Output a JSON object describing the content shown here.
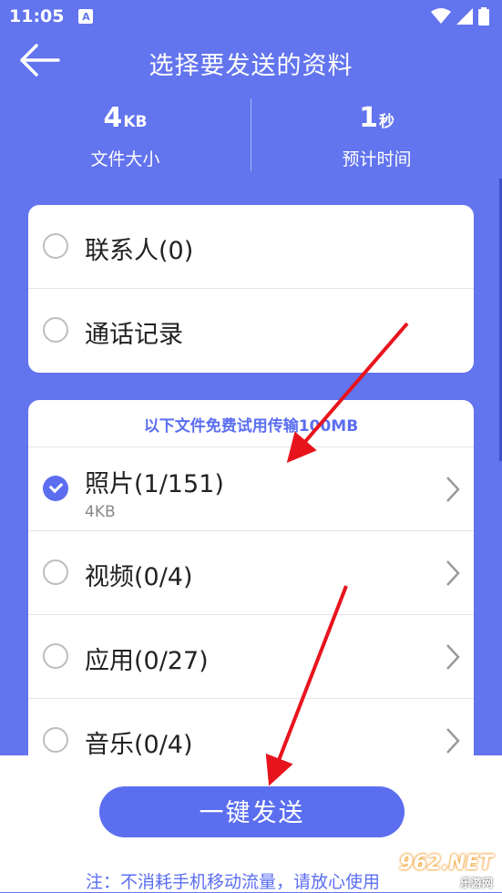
{
  "status_bar": {
    "time": "11:05",
    "notif_glyph": "A"
  },
  "header": {
    "title": "选择要发送的资料"
  },
  "stats": [
    {
      "number": "4",
      "unit": "KB",
      "label": "文件大小"
    },
    {
      "number": "1",
      "unit": "秒",
      "label": "预计时间"
    }
  ],
  "card1": {
    "items": [
      {
        "label": "联系人(0)",
        "checked": false
      },
      {
        "label": "通话记录",
        "checked": false
      }
    ]
  },
  "card2": {
    "note": "以下文件免费试用传输100MB",
    "items": [
      {
        "label": "照片(1/151)",
        "sub": "4KB",
        "checked": true
      },
      {
        "label": "视频(0/4)",
        "checked": false
      },
      {
        "label": "应用(0/27)",
        "checked": false
      },
      {
        "label": "音乐(0/4)",
        "checked": false
      }
    ]
  },
  "bottom": {
    "send_label": "一键发送",
    "footnote": "注：不消耗手机移动流量，请放心使用"
  },
  "watermark": {
    "text": "962.NET",
    "sub": "乐游网"
  },
  "colors": {
    "accent": "#5b6ef0",
    "background": "#6274ee",
    "annotation_arrow": "#e8141d"
  }
}
